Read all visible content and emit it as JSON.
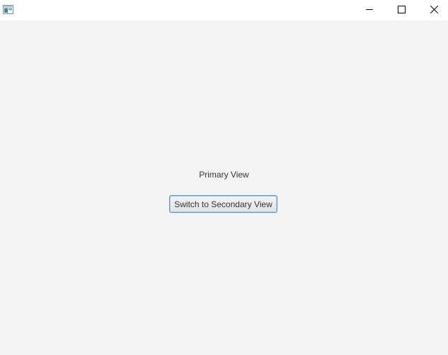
{
  "window": {
    "icon": "app-window-icon",
    "controls": {
      "minimize": "minimize-icon",
      "maximize": "maximize-icon",
      "close": "close-icon"
    }
  },
  "main": {
    "view_label": "Primary View",
    "switch_button_label": "Switch to Secondary View"
  },
  "colors": {
    "background": "#f3f3f3",
    "titlebar": "#ffffff",
    "button_focus_border": "#3c9bd8"
  }
}
